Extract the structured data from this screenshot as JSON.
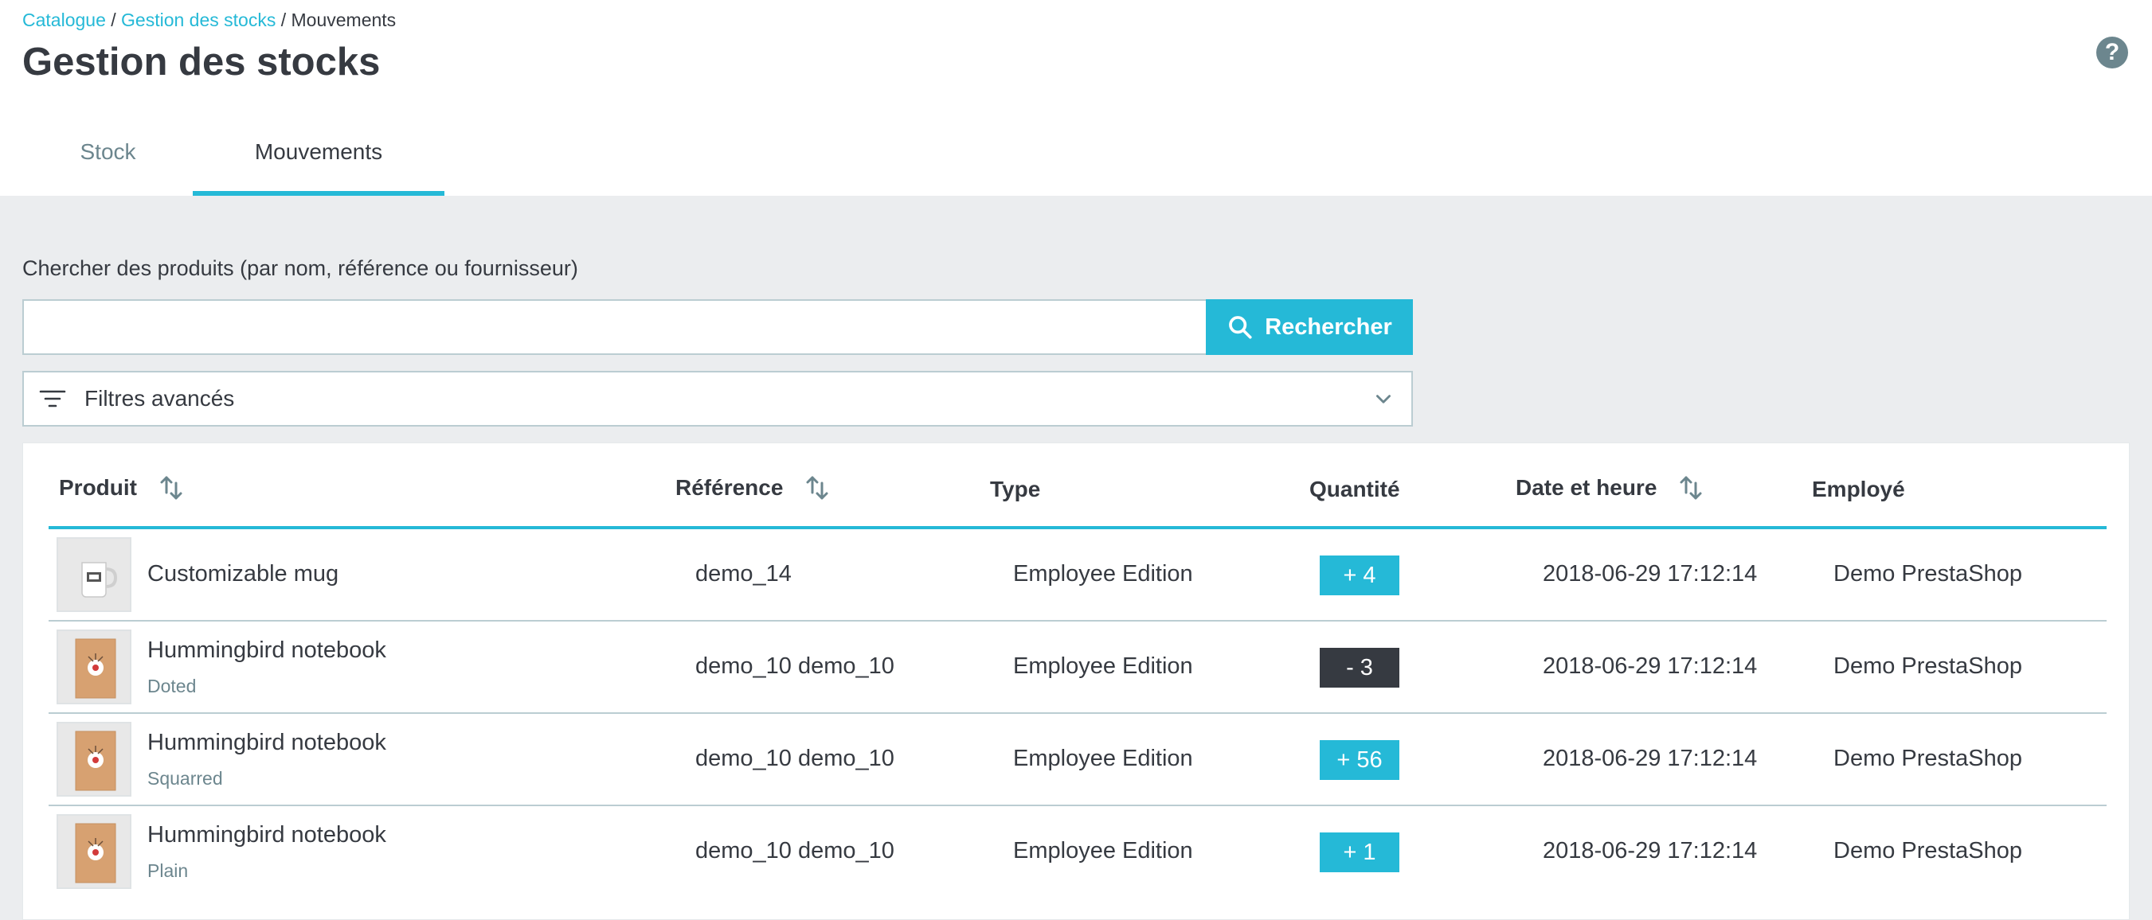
{
  "breadcrumb": {
    "items": [
      "Catalogue",
      "Gestion des stocks",
      "Mouvements"
    ],
    "separator": "/"
  },
  "page_title": "Gestion des stocks",
  "help_label": "?",
  "tabs": [
    {
      "label": "Stock",
      "active": false
    },
    {
      "label": "Mouvements",
      "active": true
    }
  ],
  "search": {
    "label": "Chercher des produits (par nom, référence ou fournisseur)",
    "value": "",
    "placeholder": "",
    "button_label": "Rechercher"
  },
  "filters": {
    "label": "Filtres avancés"
  },
  "table": {
    "columns": [
      "Produit",
      "Référence",
      "Type",
      "Quantité",
      "Date et heure",
      "Employé"
    ],
    "rows": [
      {
        "product": "Customizable mug",
        "attribute": "",
        "thumb": "mug",
        "reference": "demo_14",
        "type": "Employee Edition",
        "quantity": "+ 4",
        "qty_positive": true,
        "datetime": "2018-06-29 17:12:14",
        "employee": "Demo PrestaShop"
      },
      {
        "product": "Hummingbird notebook",
        "attribute": "Doted",
        "thumb": "notebook",
        "reference": "demo_10 demo_10",
        "type": "Employee Edition",
        "quantity": "- 3",
        "qty_positive": false,
        "datetime": "2018-06-29 17:12:14",
        "employee": "Demo PrestaShop"
      },
      {
        "product": "Hummingbird notebook",
        "attribute": "Squarred",
        "thumb": "notebook",
        "reference": "demo_10 demo_10",
        "type": "Employee Edition",
        "quantity": "+ 56",
        "qty_positive": true,
        "datetime": "2018-06-29 17:12:14",
        "employee": "Demo PrestaShop"
      },
      {
        "product": "Hummingbird notebook",
        "attribute": "Plain",
        "thumb": "notebook",
        "reference": "demo_10 demo_10",
        "type": "Employee Edition",
        "quantity": "+ 1",
        "qty_positive": true,
        "datetime": "2018-06-29 17:12:14",
        "employee": "Demo PrestaShop"
      }
    ]
  },
  "colors": {
    "accent": "#25b9d7",
    "text": "#363a41",
    "muted": "#6c868e",
    "background": "#ebedef",
    "qty_positive": "#25b9d7",
    "qty_negative": "#363a41"
  }
}
